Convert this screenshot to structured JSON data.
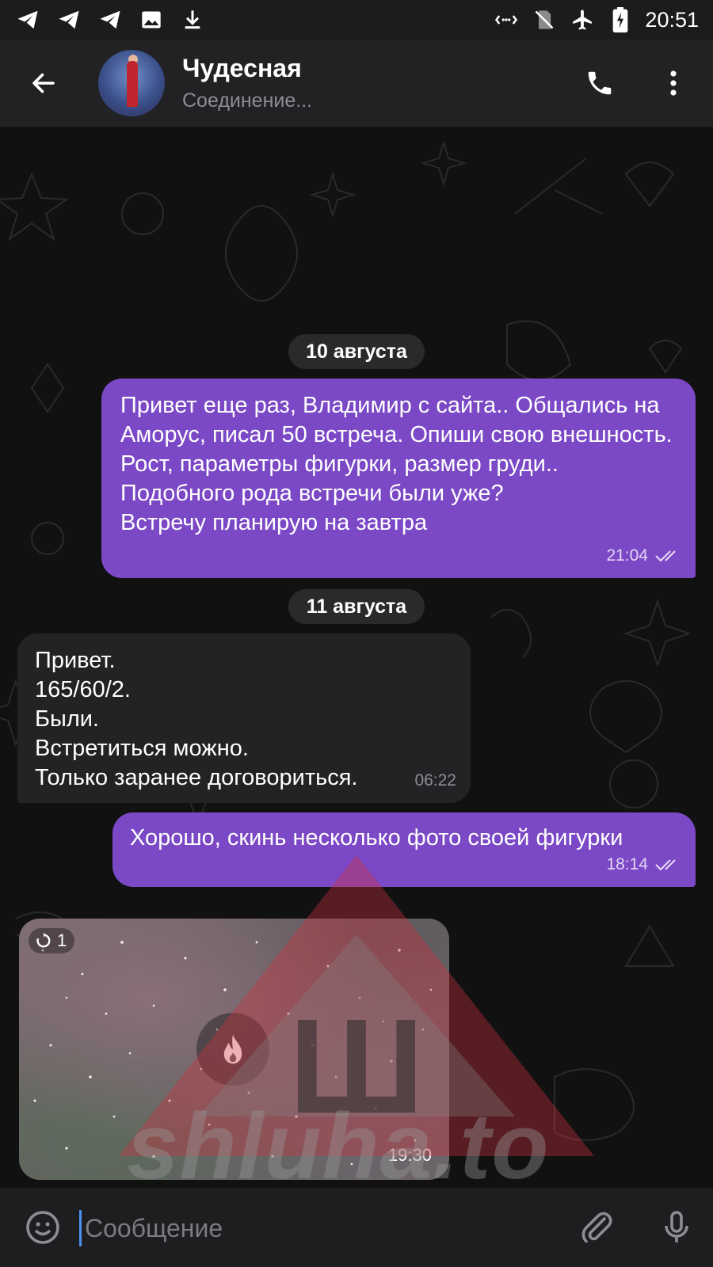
{
  "status_bar": {
    "time": "20:51",
    "left_icons": [
      "telegram-icon",
      "telegram-icon",
      "telegram-icon",
      "image-icon",
      "download-icon"
    ],
    "right_icons": [
      "data-saver-icon",
      "no-sim-icon",
      "airplane-icon",
      "battery-charging-icon"
    ]
  },
  "header": {
    "title": "Чудесная",
    "status": "Соединение..."
  },
  "messages": {
    "date1": "10 августа",
    "m1_text": "Привет еще раз, Владимир с сайта.. Общались на Аморус, писал 50 встреча. Опиши свою внешность. Рост, параметры фигурки, размер груди..\nПодобного рода встречи были уже?\nВстречу планирую на завтра",
    "m1_time": "21:04",
    "date2": "11 августа",
    "m2_text": "Привет.\n165/60/2.\nБыли.\nВстретиться можно.\nТолько заранее договориться.",
    "m2_time": "06:22",
    "m3_text": "Хорошо, скинь несколько фото своей фигурки",
    "m3_time": "18:14",
    "photo_ttl": "1",
    "photo_time": "19:30"
  },
  "watermark": {
    "letter": "Ш",
    "text": "shluha.to"
  },
  "composer": {
    "placeholder": "Сообщение"
  },
  "colors": {
    "outgoing_bubble": "#7b48c6",
    "incoming_bubble": "#232325",
    "header_bg": "#222224",
    "chat_bg": "#111112"
  }
}
